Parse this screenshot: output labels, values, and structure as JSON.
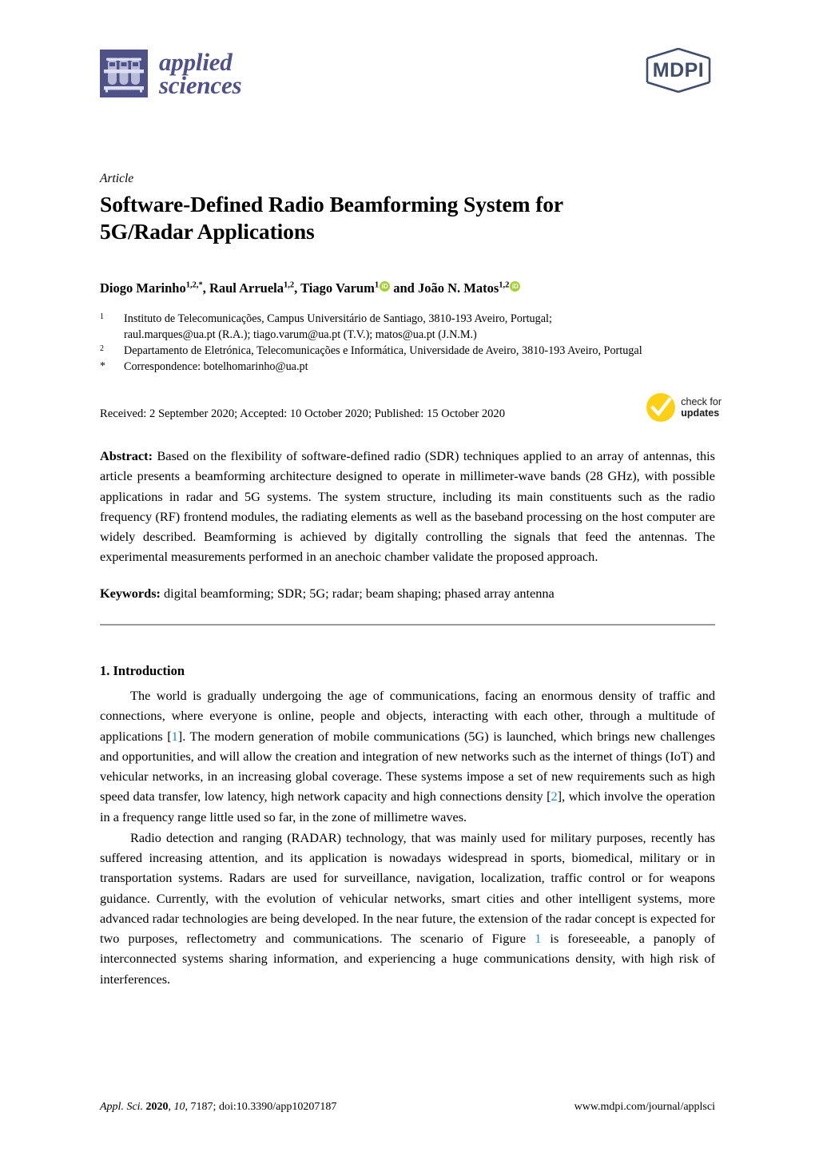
{
  "journal": {
    "name_line1": "applied",
    "name_line2": "sciences",
    "logo_icon": "test-tube-rack-icon",
    "publisher_logo": "mdpi-logo",
    "publisher_text": "MDPI",
    "accent_color": "#4f5287"
  },
  "article": {
    "type": "Article",
    "title_line1": "Software-Defined Radio Beamforming System for",
    "title_line2": "5G/Radar Applications"
  },
  "authors": {
    "a1_name": "Diogo Marinho",
    "a1_sup": "1,2,*",
    "sep1": ", ",
    "a2_name": "Raul Arruela",
    "a2_sup": "1,2",
    "sep2": ", ",
    "a3_name": "Tiago Varum",
    "a3_sup": "1",
    "orcid_label": "iD",
    "conj": " and ",
    "a4_name": "João N. Matos",
    "a4_sup": "1,2"
  },
  "affiliations": [
    {
      "marker": "1",
      "line1": "Instituto de Telecomunicações, Campus Universitário de Santiago, 3810-193 Aveiro, Portugal;",
      "line2": "raul.marques@ua.pt (R.A.); tiago.varum@ua.pt (T.V.); matos@ua.pt (J.N.M.)"
    },
    {
      "marker": "2",
      "line1": "Departamento de Eletrónica, Telecomunicações e Informática, Universidade de Aveiro, 3810-193 Aveiro, Portugal",
      "line2": ""
    },
    {
      "marker": "*",
      "line1": "Correspondence: botelhomarinho@ua.pt",
      "line2": ""
    }
  ],
  "dates": {
    "text": "Received: 2 September 2020; Accepted: 10 October 2020; Published: 15 October 2020"
  },
  "updates_badge": {
    "icon": "yellow-check-circle-icon",
    "line1": "check for",
    "line2": "updates",
    "color": "#fdd016"
  },
  "abstract": {
    "label": "Abstract:",
    "text": " Based on the flexibility of software-defined radio (SDR) techniques applied to an array of antennas, this article presents a beamforming architecture designed to operate in millimeter-wave bands (28 GHz), with possible applications in radar and 5G systems. The system structure, including its main constituents such as the radio frequency (RF) frontend modules, the radiating elements as well as the baseband processing on the host computer are widely described. Beamforming is achieved by digitally controlling the signals that feed the antennas. The experimental measurements performed in an anechoic chamber validate the proposed approach."
  },
  "keywords": {
    "label": "Keywords:",
    "text": " digital beamforming; SDR; 5G; radar; beam shaping; phased array antenna"
  },
  "body": {
    "section1_heading": "1. Introduction",
    "par1_a": "The world is gradually undergoing the age of communications, facing an enormous density of traffic and connections, where everyone is online, people and objects, interacting with each other, through a multitude of applications [",
    "par1_cite1": "1",
    "par1_b": "]. The modern generation of mobile communications (5G) is launched, which brings new challenges and opportunities, and will allow the creation and integration of new networks such as the internet of things (IoT) and vehicular networks, in an increasing global coverage. These systems impose a set of new requirements such as high speed data transfer, low latency, high network capacity and high connections density [",
    "par1_cite2": "2",
    "par1_c": "], which involve the operation in a frequency range little used so far, in the zone of millimetre waves.",
    "par2_a": "Radio detection and ranging (RADAR) technology, that was mainly used for military purposes, recently has suffered increasing attention, and its application is nowadays widespread in sports, biomedical, military or in transportation systems. Radars are used for surveillance, navigation, localization, traffic control or for weapons guidance. Currently, with the evolution of vehicular networks, smart cities and other intelligent systems, more advanced radar technologies are being developed. In the near future, the extension of the radar concept is expected for two purposes, reflectometry and communications. The scenario of Figure ",
    "par2_cite1": "1",
    "par2_b": " is foreseeable, a panoply of interconnected systems sharing information, and experiencing a huge communications density, with high risk of interferences."
  },
  "footer": {
    "journal_abbrev": "Appl. Sci.",
    "year": "2020",
    "volume": "10",
    "article_no": "7187",
    "doi": "doi:10.3390/app10207187",
    "url": "www.mdpi.com/journal/applsci"
  }
}
